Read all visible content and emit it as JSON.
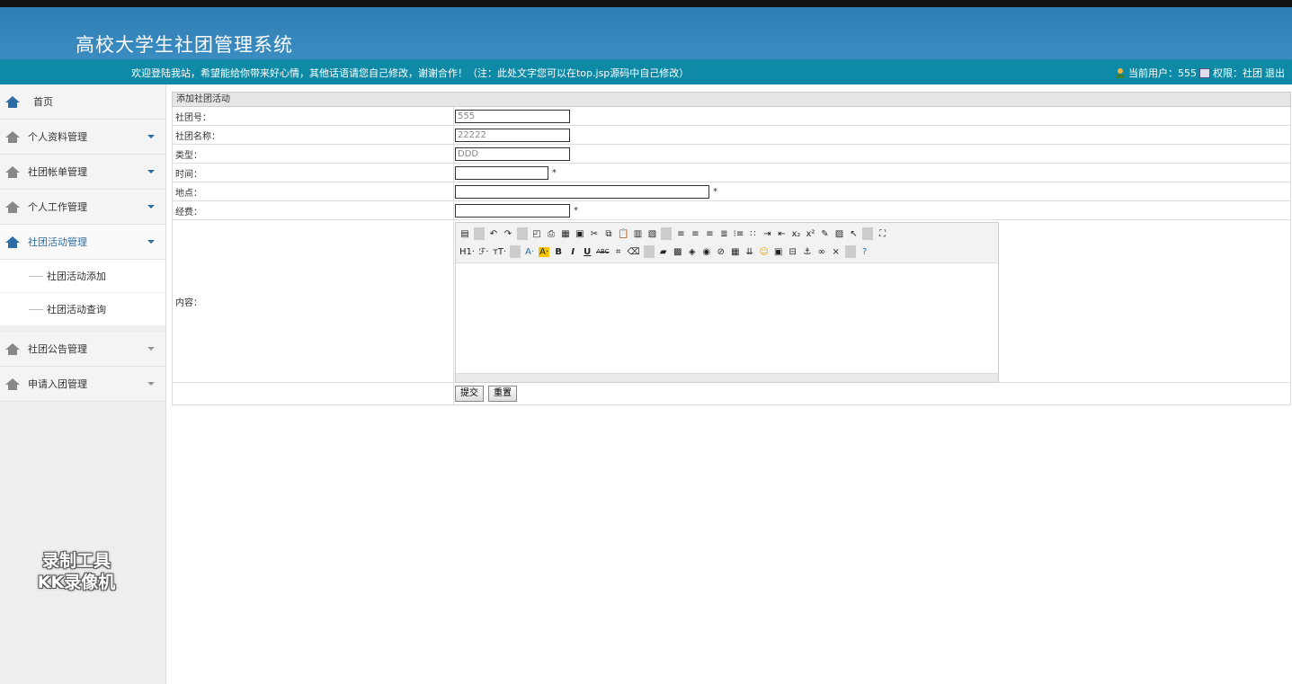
{
  "header": {
    "title": "高校大学生社团管理系统"
  },
  "notice": {
    "message": "欢迎登陆我站，希望能给你带来好心情，其他话语请您自己修改，谢谢合作！（注：此处文字您可以在top.jsp源码中自己修改）",
    "current_user_label": "当前用户：555",
    "role_label": "权限：社团",
    "logout": "退出"
  },
  "sidebar": {
    "home": "首页",
    "items": [
      {
        "label": "个人资料管理"
      },
      {
        "label": "社团帐单管理"
      },
      {
        "label": "个人工作管理"
      },
      {
        "label": "社团活动管理"
      }
    ],
    "sub_items": [
      {
        "label": "社团活动添加"
      },
      {
        "label": "社团活动查询"
      }
    ],
    "items_after": [
      {
        "label": "社团公告管理"
      },
      {
        "label": "申请入团管理"
      }
    ]
  },
  "watermark": {
    "line1": "录制工具",
    "line2": "KK录像机"
  },
  "form": {
    "title": "添加社团活动",
    "fields": {
      "club_no": {
        "label": "社团号：",
        "value": "555"
      },
      "club_name": {
        "label": "社团名称：",
        "value": "22222"
      },
      "type": {
        "label": "类型：",
        "value": "DDD"
      },
      "time": {
        "label": "时间：",
        "value": "",
        "required": "*"
      },
      "location": {
        "label": "地点：",
        "value": "",
        "required": "*"
      },
      "funds": {
        "label": "经费：",
        "value": "",
        "required": "*"
      },
      "content": {
        "label": "内容："
      }
    },
    "editor": {
      "toolbar_row2": {
        "heading": "H1·",
        "font": "ℱ·",
        "size": "тT·",
        "forecolor": "A·",
        "backcolor": "A·",
        "bold": "B",
        "italic": "I",
        "underline": "U",
        "strike": "ABC"
      }
    },
    "submit": "提交",
    "reset": "重置"
  }
}
